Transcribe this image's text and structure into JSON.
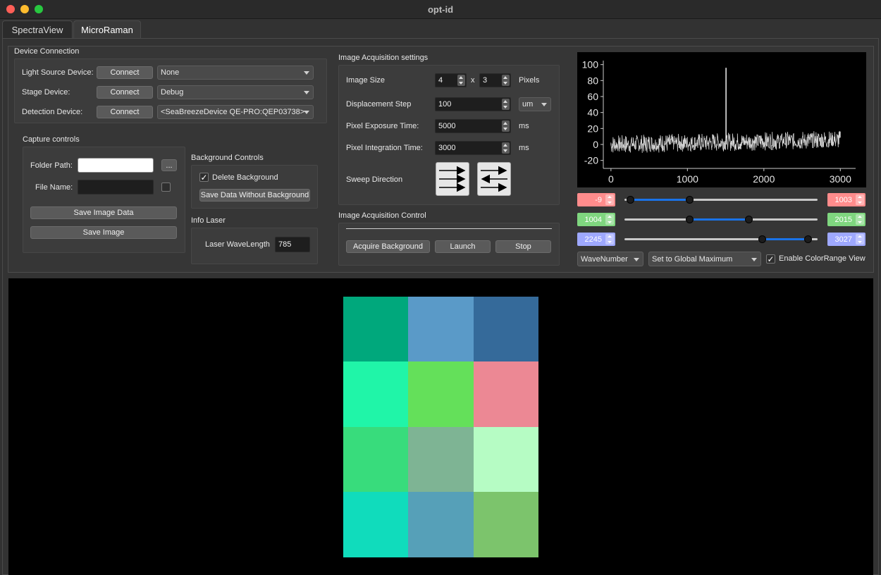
{
  "window": {
    "title": "opt-id",
    "traffic_lights": [
      {
        "name": "close",
        "color": "#ff5f57"
      },
      {
        "name": "minimize",
        "color": "#febc2e"
      },
      {
        "name": "zoom",
        "color": "#28c840"
      }
    ]
  },
  "tabs": [
    {
      "label": "SpectraView",
      "active": false
    },
    {
      "label": "MicroRaman",
      "active": true
    }
  ],
  "device_connection": {
    "title": "Device Connection",
    "rows": [
      {
        "label": "Light Source Device:",
        "button": "Connect",
        "combo": "None"
      },
      {
        "label": "Stage Device:",
        "button": "Connect",
        "combo": "Debug"
      },
      {
        "label": "Detection Device:",
        "button": "Connect",
        "combo": "<SeaBreezeDevice QE-PRO:QEP03738>"
      }
    ]
  },
  "capture_controls": {
    "title": "Capture controls",
    "folder_label": "Folder Path:",
    "folder_value": "",
    "browse_label": "...",
    "file_label": "File Name:",
    "file_value": "",
    "save_data_label": "Save Image Data",
    "save_image_label": "Save Image"
  },
  "background_controls": {
    "title": "Background Controls",
    "delete_label": "Delete Background",
    "delete_checked": true,
    "check_glyph": "✓",
    "save_without_label": "Save Data Without Background"
  },
  "info_laser": {
    "title": "Info Laser",
    "wavelength_label": "Laser WaveLength",
    "wavelength_value": "785"
  },
  "acquisition_settings": {
    "title": "Image Acquisition settings",
    "image_size_label": "Image Size",
    "width": "4",
    "times": "x",
    "height": "3",
    "pixels_unit": "Pixels",
    "step_label": "Displacement Step",
    "step_value": "100",
    "step_unit": "um",
    "exposure_label": "Pixel Exposure Time:",
    "exposure_value": "5000",
    "exposure_unit": "ms",
    "integration_label": "Pixel Integration Time:",
    "integration_value": "3000",
    "integration_unit": "ms",
    "sweep_label": "Sweep Direction"
  },
  "acquisition_control": {
    "title": "Image Acquisition Control",
    "acquire_label": "Acquire Background",
    "launch_label": "Launch",
    "stop_label": "Stop"
  },
  "chart_data": {
    "type": "line",
    "xlim": [
      -100,
      3200
    ],
    "ylim": [
      -30,
      105
    ],
    "xticks": [
      0,
      1000,
      2000,
      3000
    ],
    "yticks": [
      100,
      80,
      60,
      40,
      20,
      0,
      -20
    ],
    "peak": {
      "x": 1505,
      "y": 96
    },
    "noise_band": {
      "x_start": 0,
      "x_end": 3000,
      "y_min": -12,
      "y_max": 18
    }
  },
  "color_ranges": [
    {
      "min": "-9",
      "max": "1003",
      "color": "#ff8c8c",
      "low": -9,
      "high": 1003
    },
    {
      "min": "1004",
      "max": "2015",
      "color": "#7fd67f",
      "low": 1004,
      "high": 2015
    },
    {
      "min": "2245",
      "max": "3027",
      "color": "#9ea8ff",
      "low": 2245,
      "high": 3027
    }
  ],
  "range_scale": [
    -100,
    3200
  ],
  "bottom_controls": {
    "unit_combo": "WaveNumber",
    "mode_combo": "Set to Global Maximum",
    "colorrange_label": "Enable ColorRange View",
    "colorrange_checked": true
  },
  "image_grid": {
    "rows": 4,
    "cols": 3,
    "colors": [
      [
        "#00a87c",
        "#5a9ac8",
        "#356a9a"
      ],
      [
        "#20f5a8",
        "#64e05a",
        "#ec8894"
      ],
      [
        "#38dc7c",
        "#7eb494",
        "#b6fcc4"
      ],
      [
        "#10dcbc",
        "#56a0b8",
        "#7cc46c"
      ]
    ]
  }
}
